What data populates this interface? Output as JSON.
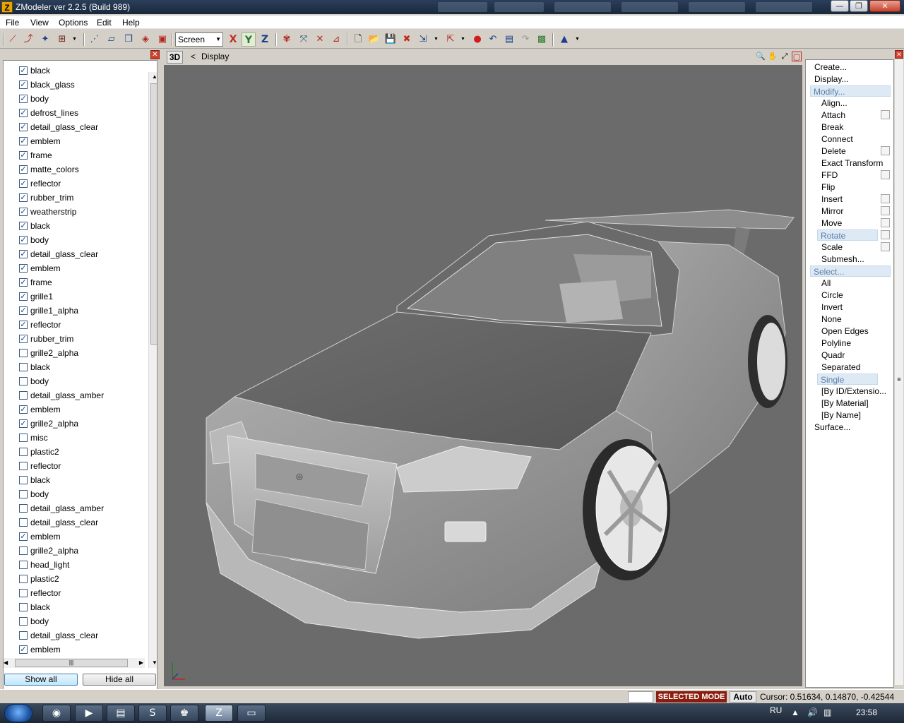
{
  "window": {
    "title": "ZModeler ver 2.2.5 (Build 989)",
    "icon_letter": "Z",
    "minimize_glyph": "—",
    "maximize_glyph": "❐",
    "close_glyph": "✕"
  },
  "menu": [
    "File",
    "View",
    "Options",
    "Edit",
    "Help"
  ],
  "toolbar": {
    "space_select": "Screen",
    "axis_x": "X",
    "axis_y": "Y",
    "axis_z": "Z"
  },
  "materials": [
    {
      "name": "black",
      "checked": true
    },
    {
      "name": "black_glass",
      "checked": true
    },
    {
      "name": "body",
      "checked": true
    },
    {
      "name": "defrost_lines",
      "checked": true
    },
    {
      "name": "detail_glass_clear",
      "checked": true
    },
    {
      "name": "emblem",
      "checked": true
    },
    {
      "name": "frame",
      "checked": true
    },
    {
      "name": "matte_colors",
      "checked": true
    },
    {
      "name": "reflector",
      "checked": true
    },
    {
      "name": "rubber_trim",
      "checked": true
    },
    {
      "name": "weatherstrip",
      "checked": true
    },
    {
      "name": "black",
      "checked": true
    },
    {
      "name": "body",
      "checked": true
    },
    {
      "name": "detail_glass_clear",
      "checked": true
    },
    {
      "name": "emblem",
      "checked": true
    },
    {
      "name": "frame",
      "checked": true
    },
    {
      "name": "grille1",
      "checked": true
    },
    {
      "name": "grille1_alpha",
      "checked": true
    },
    {
      "name": "reflector",
      "checked": true
    },
    {
      "name": "rubber_trim",
      "checked": true
    },
    {
      "name": "grille2_alpha",
      "checked": false
    },
    {
      "name": "black",
      "checked": false
    },
    {
      "name": "body",
      "checked": false
    },
    {
      "name": "detail_glass_amber",
      "checked": false
    },
    {
      "name": "emblem",
      "checked": true
    },
    {
      "name": "grille2_alpha",
      "checked": true
    },
    {
      "name": "misc",
      "checked": false
    },
    {
      "name": "plastic2",
      "checked": false
    },
    {
      "name": "reflector",
      "checked": false
    },
    {
      "name": "black",
      "checked": false
    },
    {
      "name": "body",
      "checked": false
    },
    {
      "name": "detail_glass_amber",
      "checked": false
    },
    {
      "name": "detail_glass_clear",
      "checked": false
    },
    {
      "name": "emblem",
      "checked": true
    },
    {
      "name": "grille2_alpha",
      "checked": false
    },
    {
      "name": "head_light",
      "checked": false
    },
    {
      "name": "plastic2",
      "checked": false
    },
    {
      "name": "reflector",
      "checked": false
    },
    {
      "name": "black",
      "checked": false
    },
    {
      "name": "body",
      "checked": false
    },
    {
      "name": "detail_glass_clear",
      "checked": false
    },
    {
      "name": "emblem",
      "checked": true
    }
  ],
  "left_buttons": {
    "show_all": "Show all",
    "hide_all": "Hide all"
  },
  "viewport": {
    "mode": "3D",
    "nav_arrow": "<",
    "label": "Display"
  },
  "commands": [
    {
      "label": "Create...",
      "level": 0
    },
    {
      "label": "Display...",
      "level": 0
    },
    {
      "label": "Modify...",
      "level": 0,
      "state": "highlight"
    },
    {
      "label": "Align...",
      "level": 1
    },
    {
      "label": "Attach",
      "level": 1,
      "option": true
    },
    {
      "label": "Break",
      "level": 1
    },
    {
      "label": "Connect",
      "level": 1
    },
    {
      "label": "Delete",
      "level": 1,
      "option": true
    },
    {
      "label": "Exact Transform",
      "level": 1
    },
    {
      "label": "FFD",
      "level": 1,
      "option": true
    },
    {
      "label": "Flip",
      "level": 1
    },
    {
      "label": "Insert",
      "level": 1,
      "option": true
    },
    {
      "label": "Mirror",
      "level": 1,
      "option": true
    },
    {
      "label": "Move",
      "level": 1,
      "option": true
    },
    {
      "label": "Rotate",
      "level": 1,
      "option": true,
      "state": "selected"
    },
    {
      "label": "Scale",
      "level": 1,
      "option": true
    },
    {
      "label": "Submesh...",
      "level": 1
    },
    {
      "label": "Select...",
      "level": 0,
      "state": "highlight"
    },
    {
      "label": "All",
      "level": 1
    },
    {
      "label": "Circle",
      "level": 1
    },
    {
      "label": "Invert",
      "level": 1
    },
    {
      "label": "None",
      "level": 1
    },
    {
      "label": "Open Edges",
      "level": 1
    },
    {
      "label": "Polyline",
      "level": 1
    },
    {
      "label": "Quadr",
      "level": 1
    },
    {
      "label": "Separated",
      "level": 1
    },
    {
      "label": "Single",
      "level": 1,
      "state": "selected"
    },
    {
      "label": "[By ID/Extensio...",
      "level": 1
    },
    {
      "label": "[By Material]",
      "level": 1
    },
    {
      "label": "[By Name]",
      "level": 1
    },
    {
      "label": "Surface...",
      "level": 0
    }
  ],
  "status": {
    "mode": "SELECTED MODE",
    "auto": "Auto",
    "cursor": "Cursor: 0.51634, 0.14870, -0.42544"
  },
  "taskbar": {
    "lang": "RU",
    "time": "23:58"
  },
  "colors": {
    "viewport_bg": "#6b6b6b",
    "selected_mode_bg": "#8b1c0e",
    "panel_bg": "#d4d0c8"
  }
}
